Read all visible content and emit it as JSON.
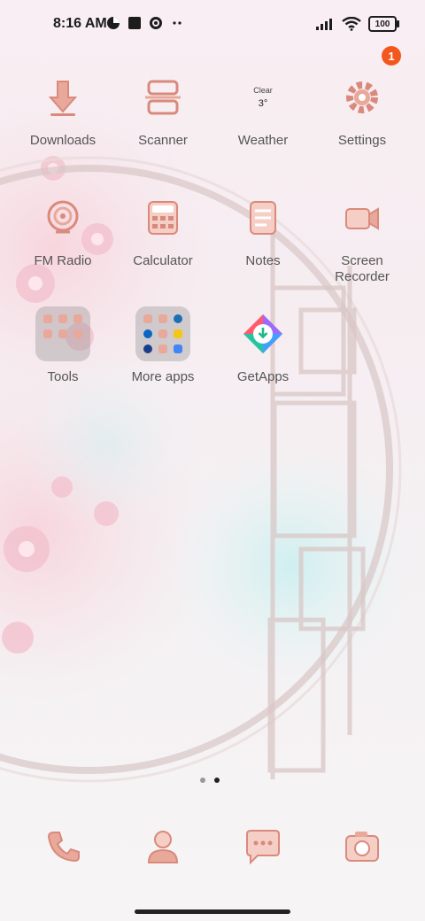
{
  "status_bar": {
    "time": "8:16 AM",
    "battery": "100",
    "left_icons": [
      "data-saver-icon",
      "square-notification-icon",
      "gear-icon",
      "more-dots-icon"
    ],
    "right_icons": [
      "signal-icon",
      "wifi-icon",
      "battery-icon"
    ]
  },
  "apps": {
    "downloads": {
      "label": "Downloads"
    },
    "scanner": {
      "label": "Scanner"
    },
    "weather": {
      "label": "Weather",
      "condition": "Clear",
      "temp": "3°"
    },
    "settings": {
      "label": "Settings",
      "badge": "1"
    },
    "fm_radio": {
      "label": "FM Radio"
    },
    "calculator": {
      "label": "Calculator"
    },
    "notes": {
      "label": "Notes"
    },
    "screen_recorder": {
      "label": "Screen\nRecorder"
    },
    "tools": {
      "label": "Tools"
    },
    "more_apps": {
      "label": "More apps"
    },
    "getapps": {
      "label": "GetApps"
    }
  },
  "dock": [
    "phone-icon",
    "contacts-icon",
    "messages-icon",
    "camera-icon"
  ],
  "page_indicator": {
    "count": 2,
    "active": 2
  },
  "colors": {
    "icon_pink": "#e8a89a",
    "icon_deep": "#d98a7c",
    "badge": "#f2571d"
  }
}
